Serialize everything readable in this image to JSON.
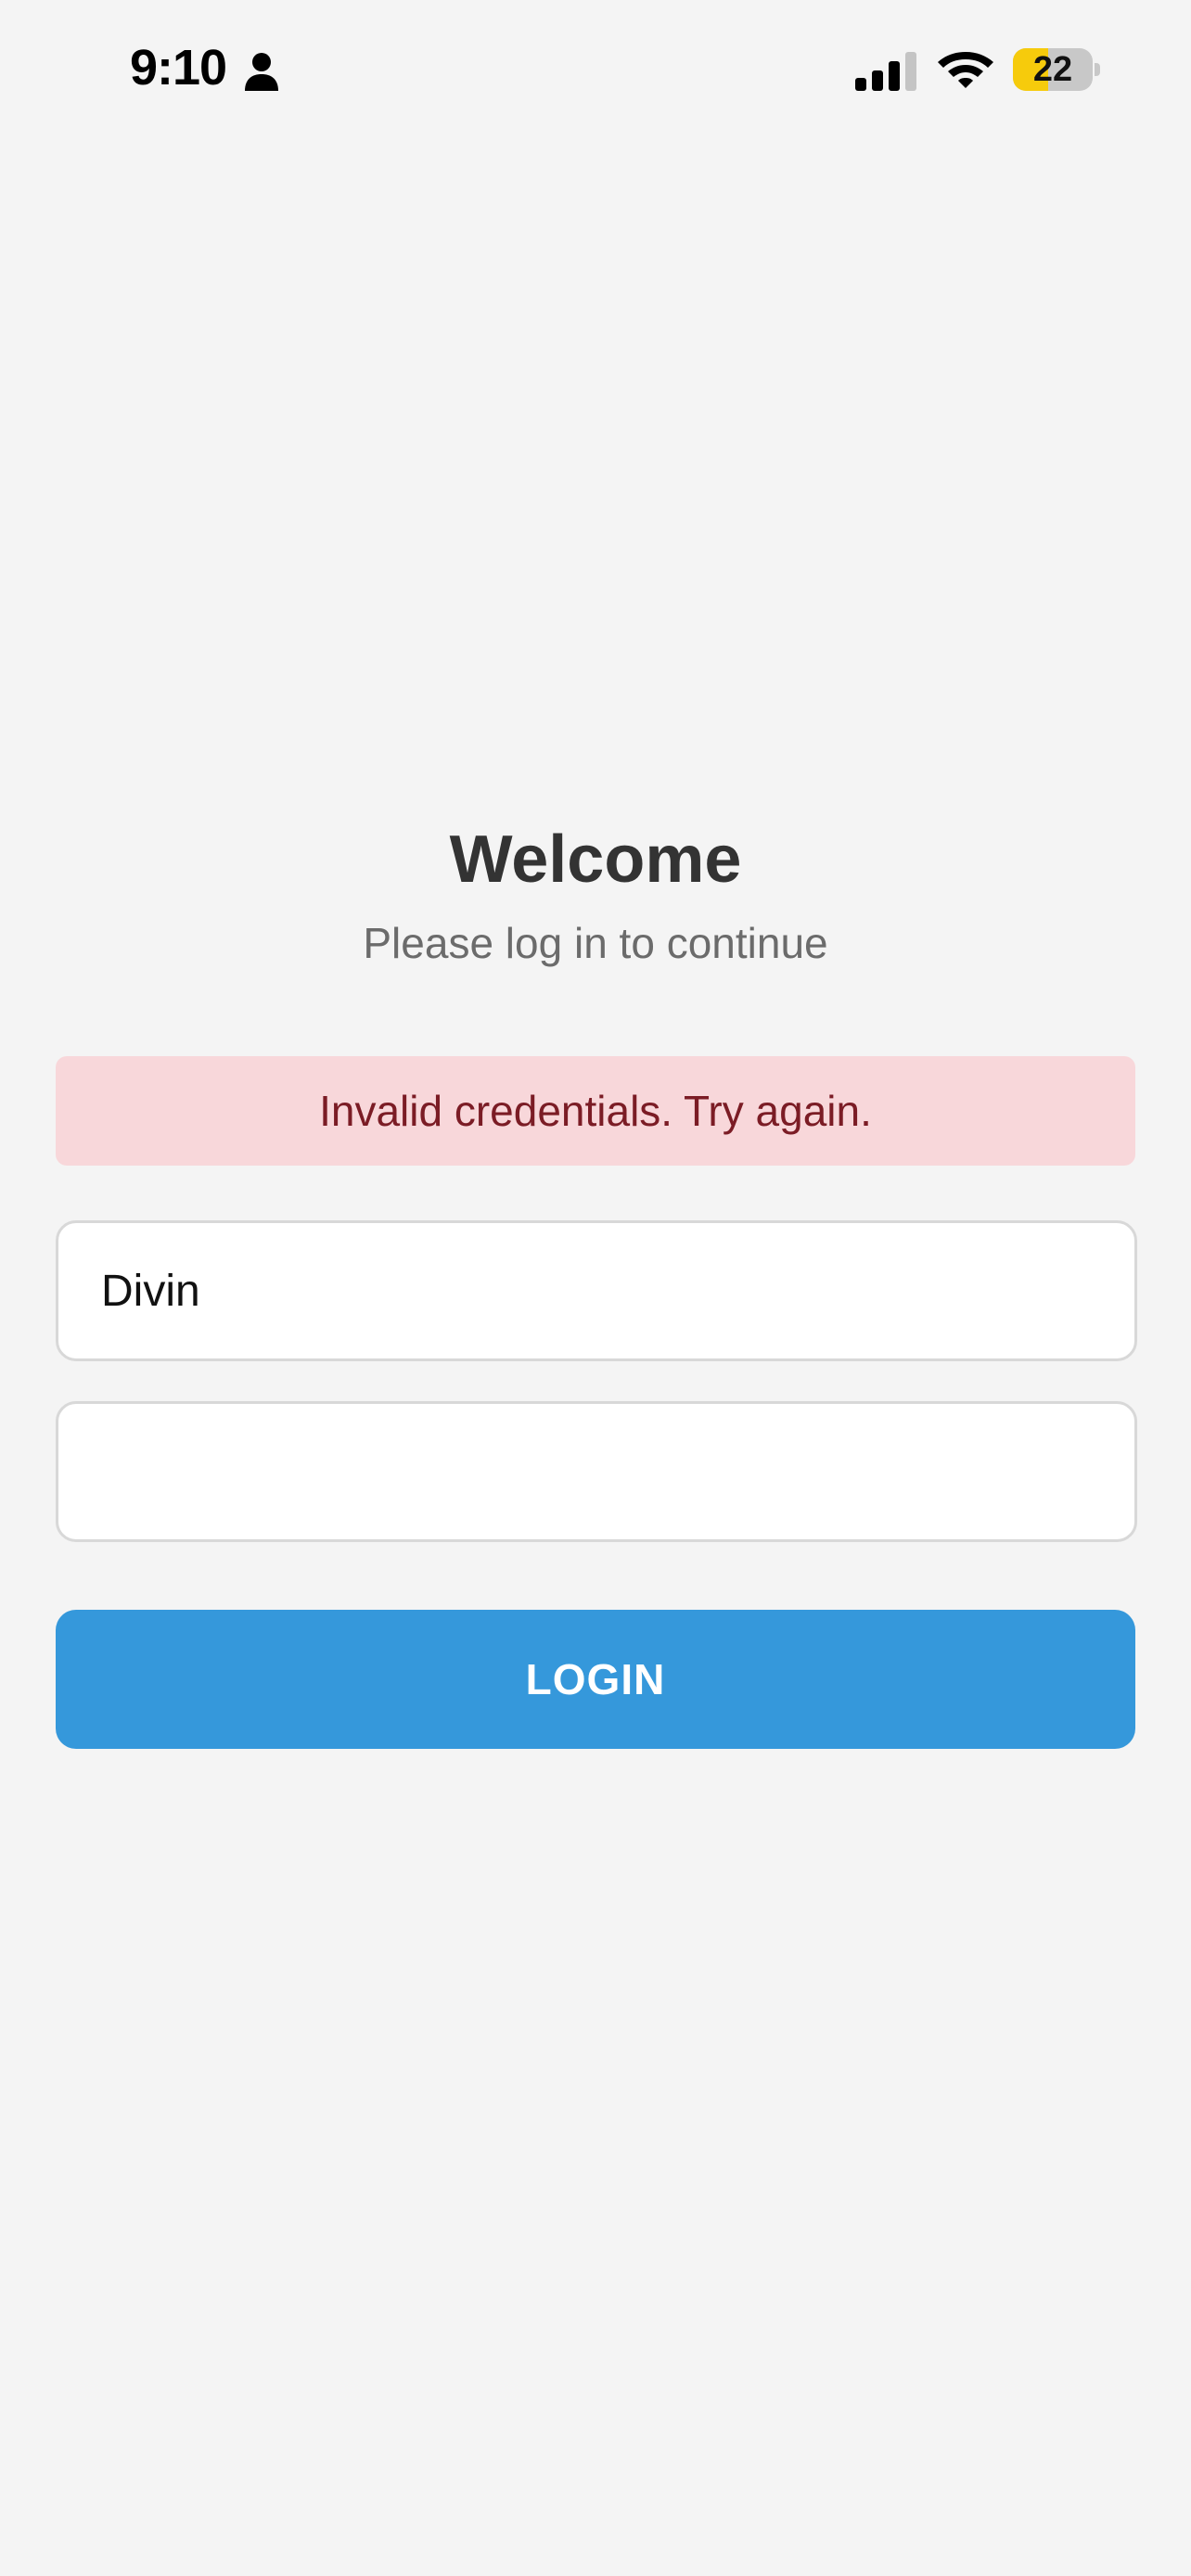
{
  "status_bar": {
    "time": "9:10",
    "battery_level": "22",
    "battery_fraction": 0.22,
    "icons": [
      "person-icon",
      "cellular-signal-icon",
      "wifi-icon",
      "battery-icon"
    ]
  },
  "login": {
    "title": "Welcome",
    "subtitle": "Please log in to continue",
    "error_message": "Invalid credentials. Try again.",
    "username_value": "Divin",
    "password_value": "",
    "button_label": "LOGIN"
  },
  "colors": {
    "background": "#f4f4f4",
    "error_background": "#f8d7da",
    "error_text": "#7b1c25",
    "button": "#3598db",
    "battery_fill": "#f6cb0c"
  }
}
